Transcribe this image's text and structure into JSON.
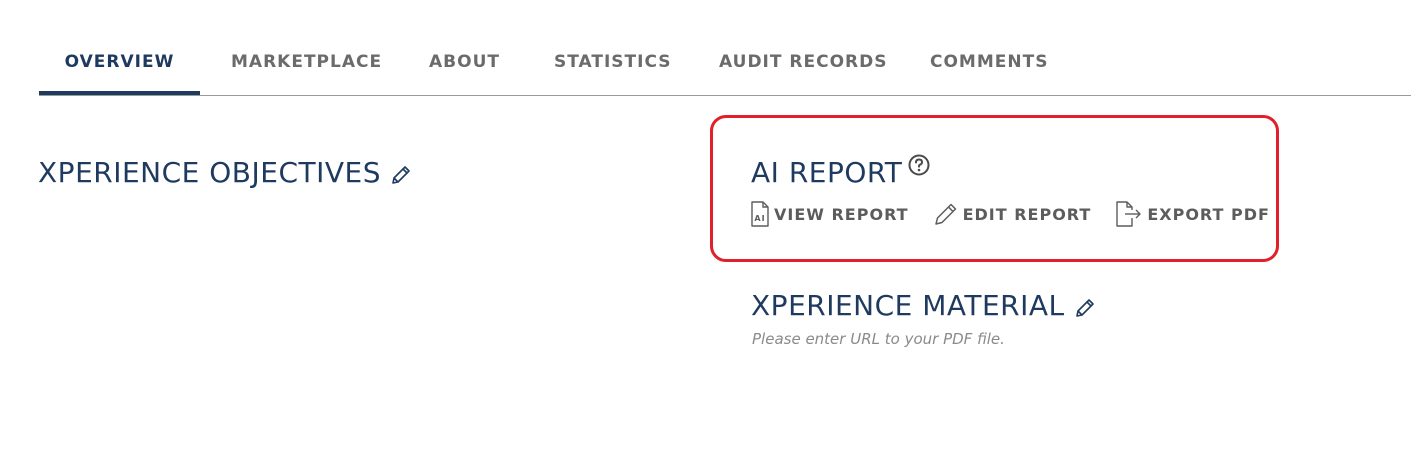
{
  "tabs": [
    {
      "label": "OVERVIEW",
      "active": true
    },
    {
      "label": "MARKETPLACE",
      "active": false
    },
    {
      "label": "ABOUT",
      "active": false
    },
    {
      "label": "STATISTICS",
      "active": false
    },
    {
      "label": "AUDIT RECORDS",
      "active": false
    },
    {
      "label": "COMMENTS",
      "active": false
    }
  ],
  "objectives": {
    "title": "XPERIENCE OBJECTIVES",
    "edit_icon": "pencil-icon"
  },
  "ai_report": {
    "title": "AI REPORT",
    "help_icon": "question-circle-icon",
    "highlight_color": "#e0202a",
    "actions": [
      {
        "label": "VIEW REPORT",
        "icon": "ai-document-icon"
      },
      {
        "label": "EDIT REPORT",
        "icon": "pencil-icon"
      },
      {
        "label": "EXPORT PDF",
        "icon": "file-export-icon"
      }
    ]
  },
  "material": {
    "title": "XPERIENCE MATERIAL",
    "edit_icon": "pencil-icon",
    "placeholder": "Please enter URL to your PDF file."
  },
  "colors": {
    "accent": "#1f3a5f",
    "tab_text": "#6b6b6b",
    "highlight": "#e0202a"
  }
}
